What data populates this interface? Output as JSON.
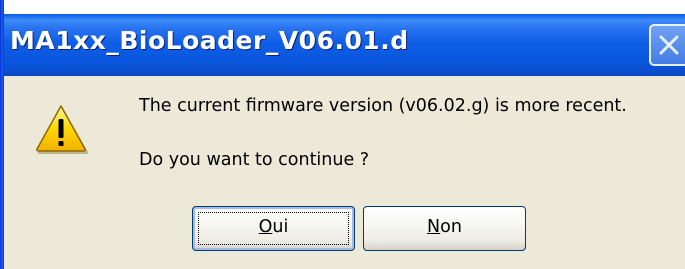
{
  "window": {
    "title": "MA1xx_BioLoader_V06.01.d"
  },
  "dialog": {
    "icon": "warning-icon",
    "message": "The current firmware version (v06.02.g) is more recent.",
    "question": "Do you want to continue ?"
  },
  "buttons": {
    "yes": {
      "accel": "O",
      "rest": "ui",
      "icon": ""
    },
    "no": {
      "accel": "N",
      "rest": "on"
    }
  },
  "colors": {
    "titlebar": "#0a57de",
    "dialog_bg": "#ece9d8",
    "warning_fill": "#ffcc00"
  }
}
